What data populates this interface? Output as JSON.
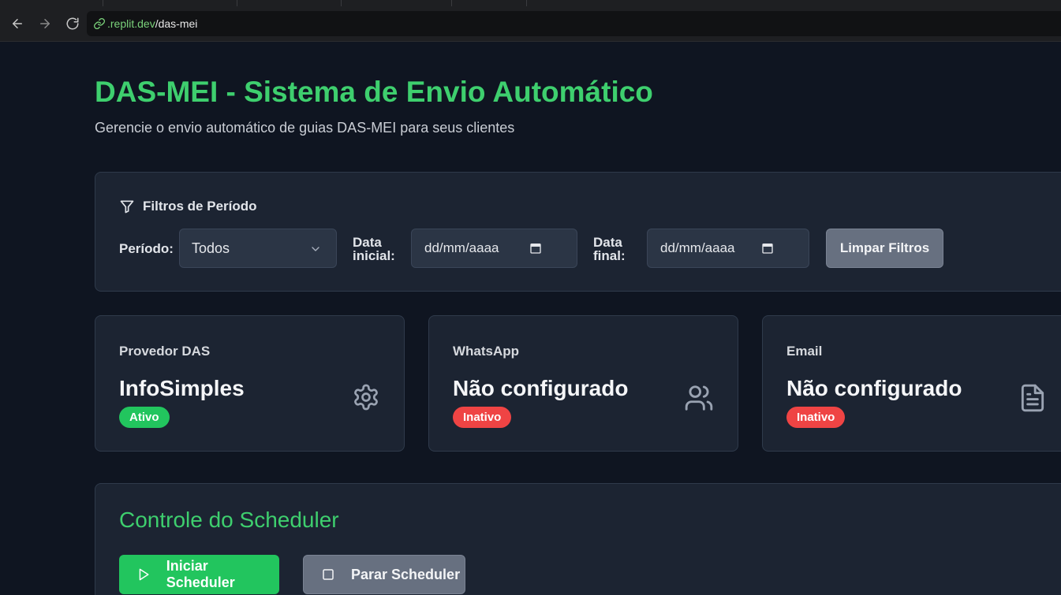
{
  "browser": {
    "url_domain": ".replit.dev",
    "url_path": "/das-mei"
  },
  "header": {
    "title": "DAS-MEI - Sistema de Envio Automático",
    "subtitle": "Gerencie o envio automático de guias DAS-MEI para seus clientes"
  },
  "filters": {
    "heading": "Filtros de Período",
    "period_label": "Período:",
    "period_value": "Todos",
    "start_label_line1": "Data",
    "start_label_line2": "inicial:",
    "start_value": "dd/mm/aaaa",
    "end_label_line1": "Data",
    "end_label_line2": "final:",
    "end_value": "dd/mm/aaaa",
    "clear_label": "Limpar Filtros"
  },
  "stats": [
    {
      "label": "Provedor DAS",
      "value": "InfoSimples",
      "badge": "Ativo",
      "badge_color": "#22c55e",
      "icon": "gear-icon"
    },
    {
      "label": "WhatsApp",
      "value": "Não configurado",
      "badge": "Inativo",
      "badge_color": "#ef4444",
      "icon": "users-icon"
    },
    {
      "label": "Email",
      "value": "Não configurado",
      "badge": "Inativo",
      "badge_color": "#ef4444",
      "icon": "document-icon"
    }
  ],
  "scheduler": {
    "title": "Controle do Scheduler",
    "start_label": "Iniciar Scheduler",
    "stop_label": "Parar Scheduler"
  },
  "colors": {
    "accent_green": "#3ecf6e",
    "active": "#22c55e",
    "inactive": "#ef4444"
  }
}
